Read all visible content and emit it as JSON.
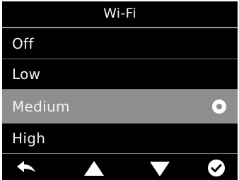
{
  "header": {
    "title": "Wi-Fi"
  },
  "menu": {
    "items": [
      {
        "label": "Off"
      },
      {
        "label": "Low"
      },
      {
        "label": "Medium",
        "selected": true
      },
      {
        "label": "High"
      }
    ]
  },
  "toolbar": {
    "buttons": [
      {
        "icon": "back-arrow-icon"
      },
      {
        "icon": "triangle-up-icon"
      },
      {
        "icon": "triangle-down-icon"
      },
      {
        "icon": "check-circle-icon"
      }
    ]
  },
  "colors": {
    "background": "#000000",
    "text": "#f2f2f2",
    "selected_row": "#8e8e8e",
    "divider": "#7a7a7a"
  }
}
